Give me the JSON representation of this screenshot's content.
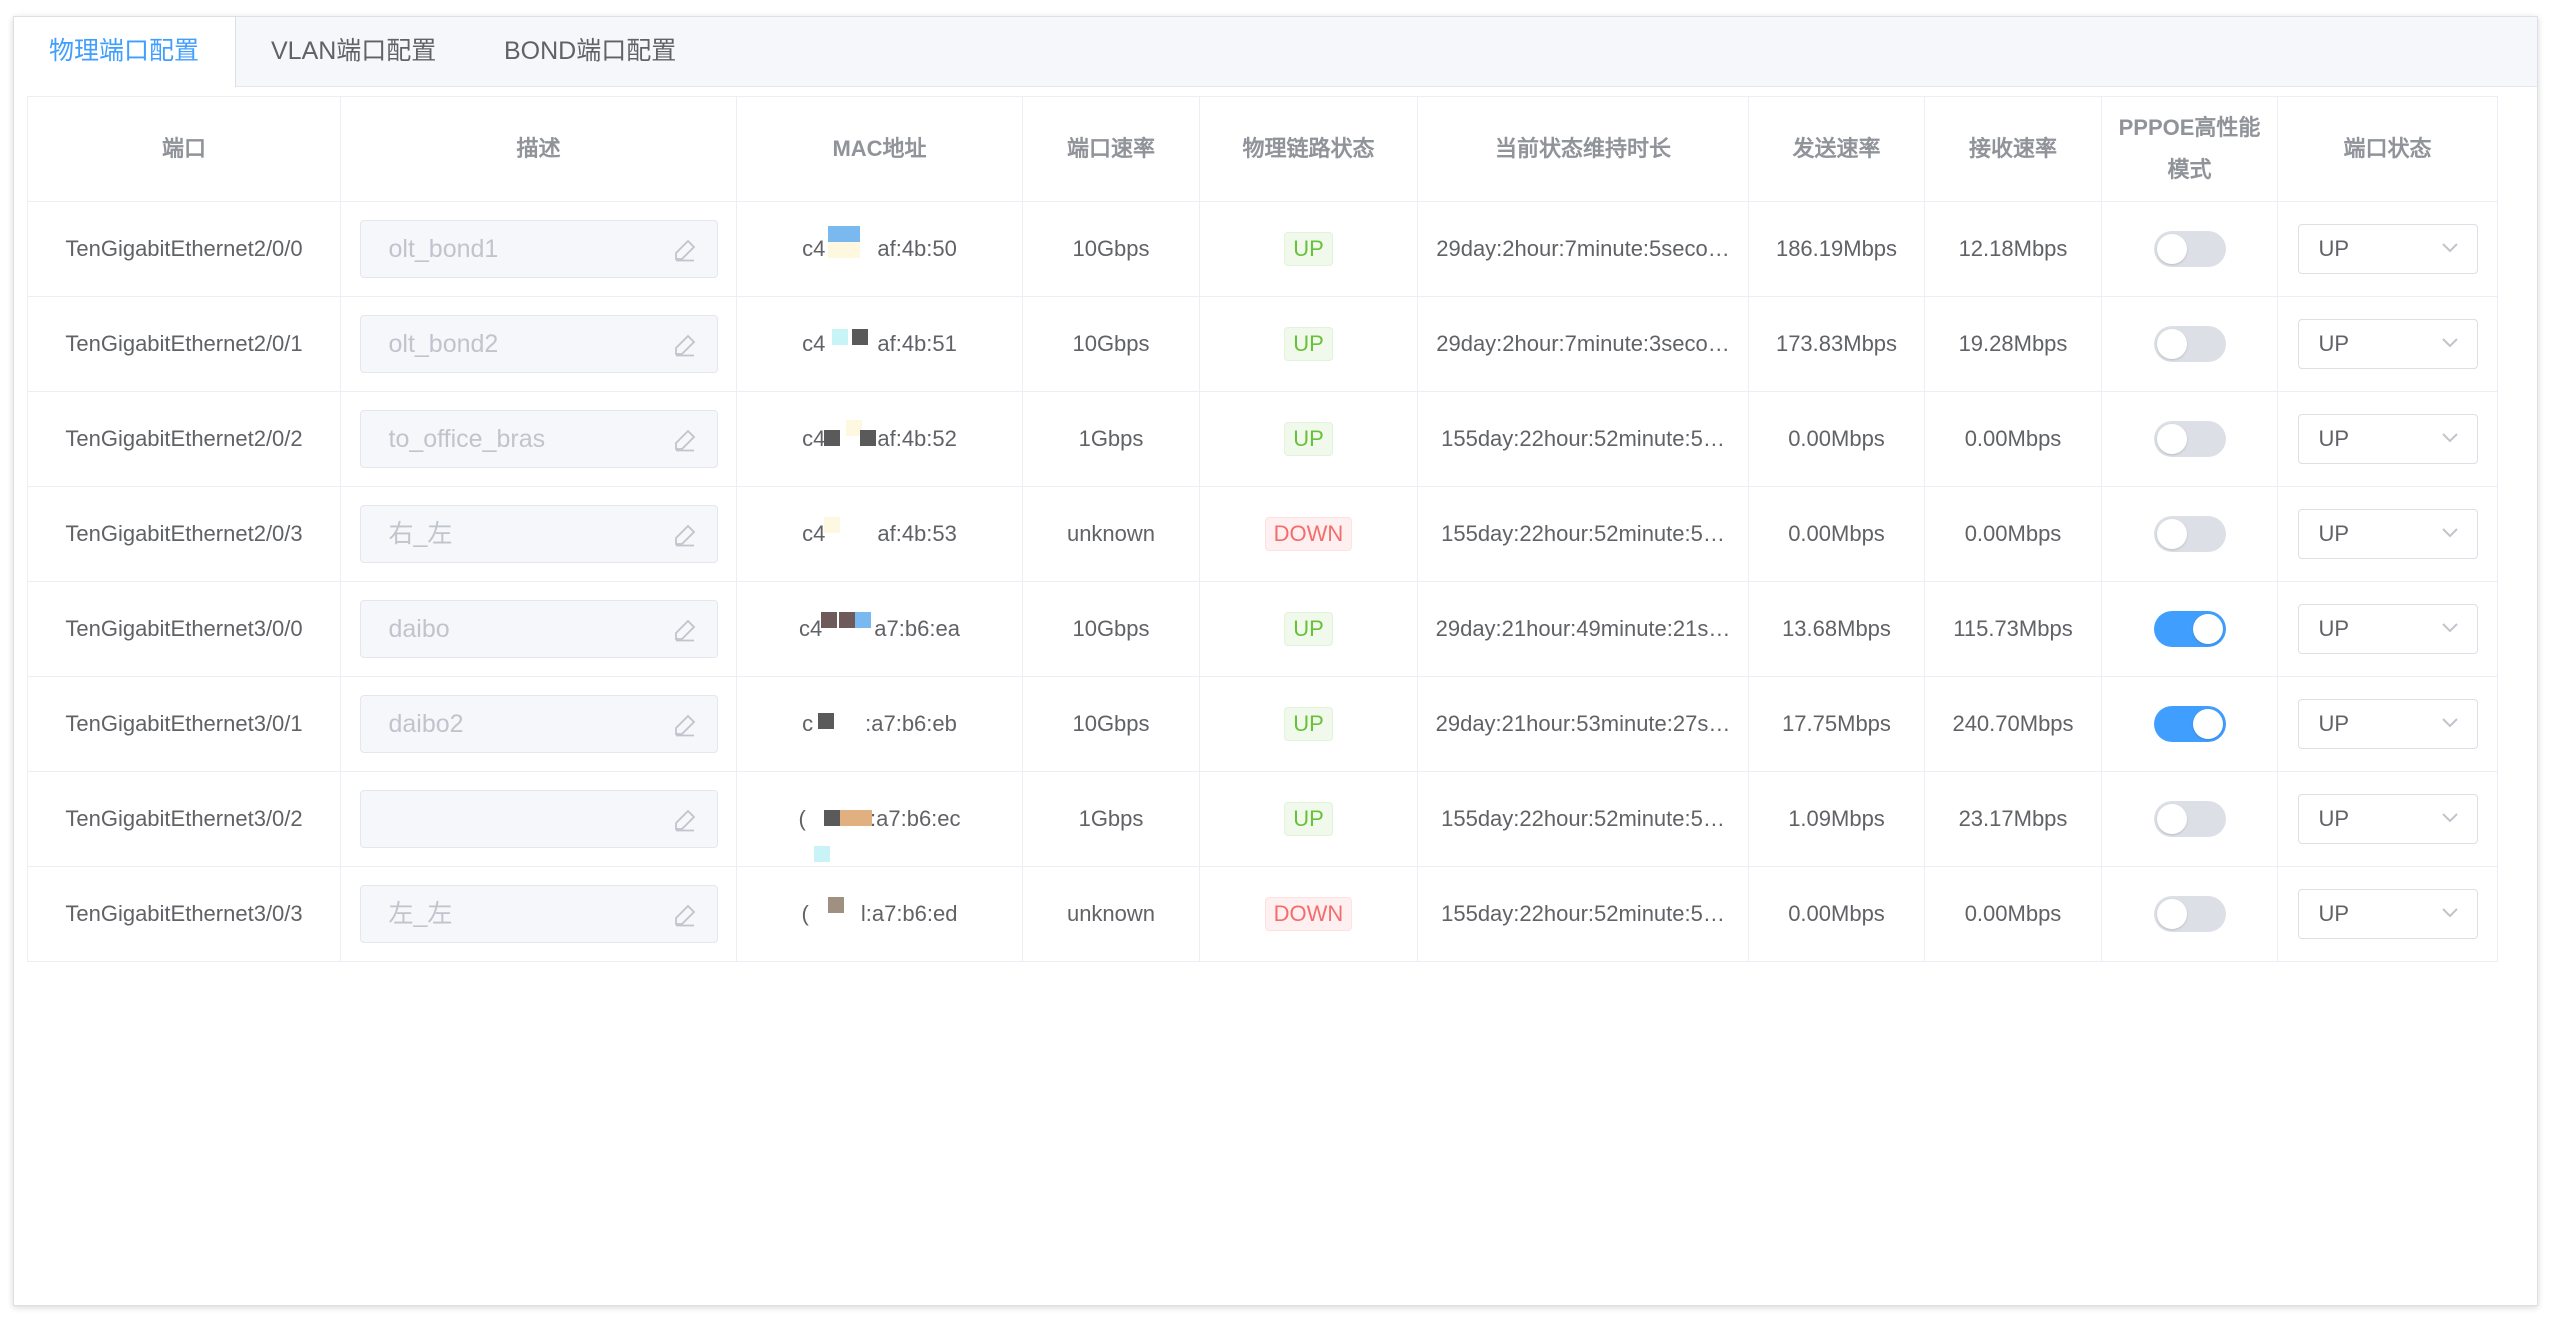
{
  "tabs": [
    {
      "label": "物理端口配置",
      "active": true
    },
    {
      "label": "VLAN端口配置",
      "active": false
    },
    {
      "label": "BOND端口配置",
      "active": false
    }
  ],
  "columns": {
    "port": "端口",
    "desc": "描述",
    "mac": "MAC地址",
    "speed": "端口速率",
    "link": "物理链路状态",
    "duration": "当前状态维持时长",
    "tx": "发送速率",
    "rx": "接收速率",
    "pppoe": "PPPOE高性能模式",
    "state": "端口状态"
  },
  "rows": [
    {
      "port": "TenGigabitEthernet2/0/0",
      "desc": "olt_bond1",
      "mac_prefix": "c4",
      "mac_suffix": "af:4b:50",
      "speed": "10Gbps",
      "link": "UP",
      "duration": "29day:2hour:7minute:5seco…",
      "tx": "186.19Mbps",
      "rx": "12.18Mbps",
      "pppoe": false,
      "state": "UP"
    },
    {
      "port": "TenGigabitEthernet2/0/1",
      "desc": "olt_bond2",
      "mac_prefix": "c4",
      "mac_suffix": "af:4b:51",
      "speed": "10Gbps",
      "link": "UP",
      "duration": "29day:2hour:7minute:3seco…",
      "tx": "173.83Mbps",
      "rx": "19.28Mbps",
      "pppoe": false,
      "state": "UP"
    },
    {
      "port": "TenGigabitEthernet2/0/2",
      "desc": "to_office_bras",
      "mac_prefix": "c4",
      "mac_suffix": "af:4b:52",
      "speed": "1Gbps",
      "link": "UP",
      "duration": "155day:22hour:52minute:5…",
      "tx": "0.00Mbps",
      "rx": "0.00Mbps",
      "pppoe": false,
      "state": "UP"
    },
    {
      "port": "TenGigabitEthernet2/0/3",
      "desc": "右_左",
      "mac_prefix": "c4",
      "mac_suffix": "af:4b:53",
      "speed": "unknown",
      "link": "DOWN",
      "duration": "155day:22hour:52minute:5…",
      "tx": "0.00Mbps",
      "rx": "0.00Mbps",
      "pppoe": false,
      "state": "UP"
    },
    {
      "port": "TenGigabitEthernet3/0/0",
      "desc": "daibo",
      "mac_prefix": "c4",
      "mac_suffix": "a7:b6:ea",
      "speed": "10Gbps",
      "link": "UP",
      "duration": "29day:21hour:49minute:21s…",
      "tx": "13.68Mbps",
      "rx": "115.73Mbps",
      "pppoe": true,
      "state": "UP"
    },
    {
      "port": "TenGigabitEthernet3/0/1",
      "desc": "daibo2",
      "mac_prefix": "c",
      "mac_suffix": ":a7:b6:eb",
      "speed": "10Gbps",
      "link": "UP",
      "duration": "29day:21hour:53minute:27s…",
      "tx": "17.75Mbps",
      "rx": "240.70Mbps",
      "pppoe": true,
      "state": "UP"
    },
    {
      "port": "TenGigabitEthernet3/0/2",
      "desc": "",
      "mac_prefix": "(",
      "mac_suffix": "d:a7:b6:ec",
      "speed": "1Gbps",
      "link": "UP",
      "duration": "155day:22hour:52minute:5…",
      "tx": "1.09Mbps",
      "rx": "23.17Mbps",
      "pppoe": false,
      "state": "UP"
    },
    {
      "port": "TenGigabitEthernet3/0/3",
      "desc": "左_左",
      "mac_prefix": "(",
      "mac_suffix": "l:a7:b6:ed",
      "speed": "unknown",
      "link": "DOWN",
      "duration": "155day:22hour:52minute:5…",
      "tx": "0.00Mbps",
      "rx": "0.00Mbps",
      "pppoe": false,
      "state": "UP"
    }
  ],
  "colors": {
    "accent": "#409eff",
    "up": "#67c23a",
    "down": "#f56c6c",
    "redaction": [
      "#5a5a5a",
      "#7ab8f0",
      "#c8f4f8",
      "#6e5a5a",
      "#e0b080",
      "#a09080",
      "#fff8e0"
    ]
  },
  "icons": {
    "edit": "edit-icon",
    "dropdown": "chevron-down-icon"
  }
}
